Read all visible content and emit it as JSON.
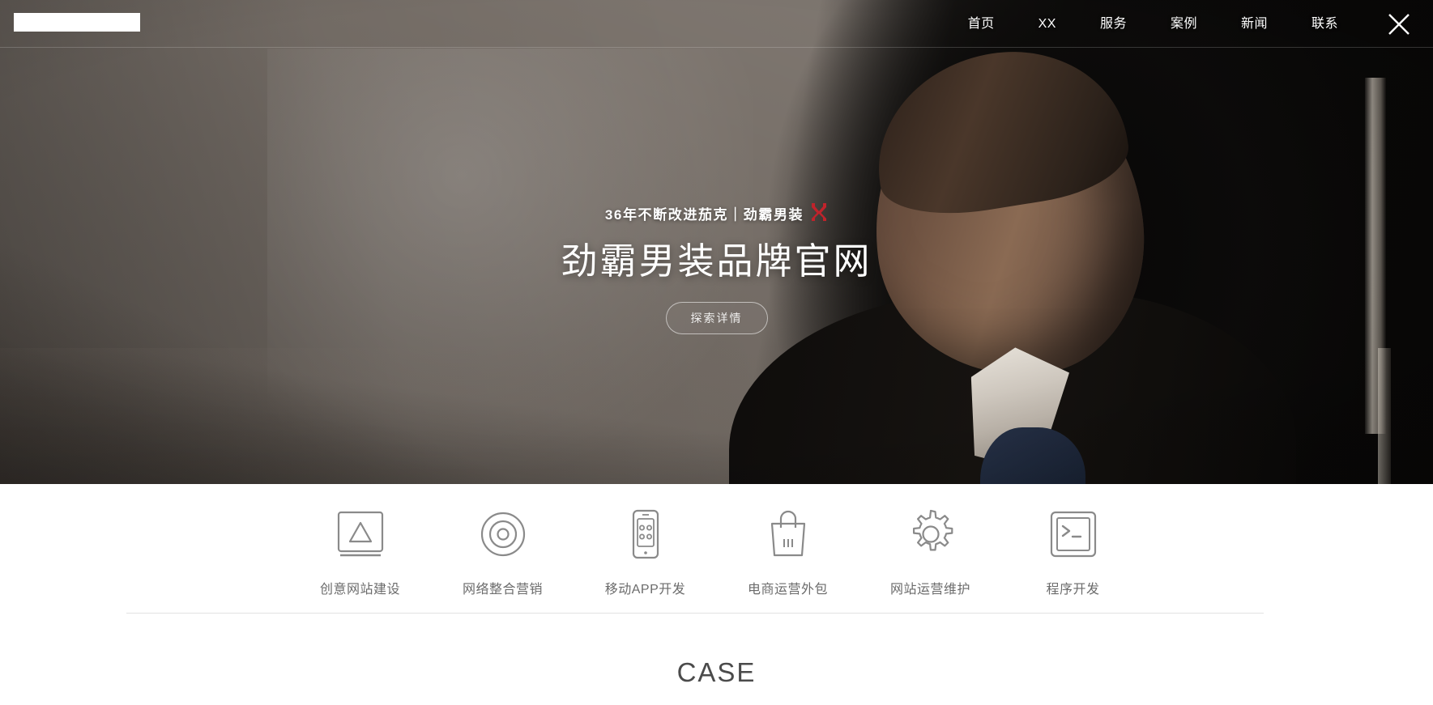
{
  "header": {
    "logo_placeholder": "",
    "nav_items": [
      {
        "label": "首页"
      },
      {
        "label": "XX"
      },
      {
        "label": "服务"
      },
      {
        "label": "案例"
      },
      {
        "label": "新闻"
      },
      {
        "label": "联系"
      }
    ],
    "close_icon": "close-icon"
  },
  "hero": {
    "subtitle": "36年不断改进茄克｜劲霸男装",
    "brand_mark_color": "#c0232b",
    "title": "劲霸男装品牌官网",
    "cta_label": "探索详情",
    "background_description": "studio-portrait-photo"
  },
  "services": {
    "items": [
      {
        "label": "创意网站建设",
        "icon": "square-triangle-icon"
      },
      {
        "label": "网络整合营销",
        "icon": "concentric-circles-icon"
      },
      {
        "label": "移动APP开发",
        "icon": "mobile-phone-icon"
      },
      {
        "label": "电商运营外包",
        "icon": "shopping-bag-icon"
      },
      {
        "label": "网站运营维护",
        "icon": "gear-icon"
      },
      {
        "label": "程序开发",
        "icon": "terminal-prompt-icon"
      }
    ]
  },
  "case_section": {
    "heading": "CASE"
  },
  "colors": {
    "accent_red": "#c0232b",
    "icon_stroke": "#8a8a8a",
    "text_gray": "#6b6b6b",
    "heading_gray": "#4b4b4b",
    "divider": "#e3e3e3"
  }
}
